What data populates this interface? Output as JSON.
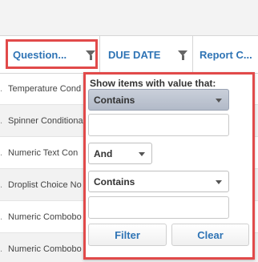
{
  "columns": {
    "question": "Question...",
    "due_date": "DUE DATE",
    "report": "Report C..."
  },
  "rows": [
    {
      "text": "Temperature Cond"
    },
    {
      "text": "Spinner Conditiona"
    },
    {
      "text": "Numeric Text Con"
    },
    {
      "text": "Droplist Choice No"
    },
    {
      "text": "Numeric Combobo"
    },
    {
      "text": "Numeric Combobo"
    }
  ],
  "filter_popup": {
    "title": "Show items with value that:",
    "condition1": "Contains",
    "value1": "",
    "logic": "And",
    "condition2": "Contains",
    "value2": "",
    "filter_label": "Filter",
    "clear_label": "Clear"
  },
  "colors": {
    "accent": "#2f74b5",
    "highlight": "#e14a4a"
  }
}
